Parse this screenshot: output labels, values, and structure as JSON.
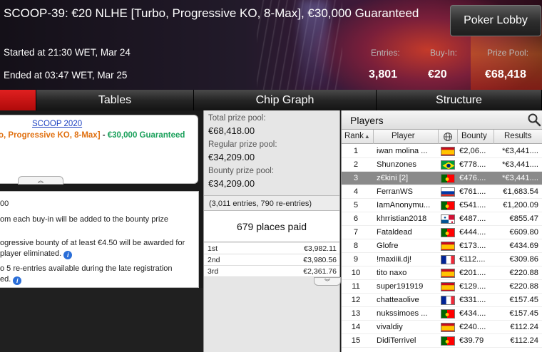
{
  "header": {
    "title": "SCOOP-39: €20 NLHE [Turbo, Progressive KO, 8-Max], €30,000 Guaranteed",
    "started": "Started at 21:30 WET, Mar 24",
    "ended": "Ended at 03:47 WET, Mar 25",
    "lobby_button": "Poker Lobby",
    "stats": [
      {
        "label": "Entries:",
        "value": "3,801"
      },
      {
        "label": "Buy-In:",
        "value": "€20"
      },
      {
        "label": "Prize Pool:",
        "value": "€68,418"
      }
    ]
  },
  "tabs": [
    {
      "label": ""
    },
    {
      "label": "Tables"
    },
    {
      "label": "Chip Graph"
    },
    {
      "label": "Structure"
    }
  ],
  "info": {
    "series_link": "SCOOP 2020",
    "name_orange": "o, Progressive KO, 8-Max]",
    "name_sep": " - ",
    "name_green": "€30,000 Guaranteed",
    "lines": [
      "00",
      "om each buy-in will be added to the bounty prize",
      "",
      "ogressive bounty of at least €4.50 will be awarded for",
      " player eliminated.",
      "o 5 re-entries available during the late registration",
      "ed."
    ]
  },
  "prizes": {
    "total_label": "Total prize pool:",
    "total_value": "€68,418.00",
    "regular_label": "Regular prize pool:",
    "regular_value": "€34,209.00",
    "bounty_label": "Bounty prize pool:",
    "bounty_value": "€34,209.00",
    "entries_text": "(3,011 entries, 790 re-entries)",
    "places_paid": "679 places paid",
    "table": [
      {
        "place": "1st",
        "amount": "€3,982.11"
      },
      {
        "place": "2nd",
        "amount": "€3,980.56"
      },
      {
        "place": "3rd",
        "amount": "€2,361.76"
      }
    ]
  },
  "players": {
    "title": "Players",
    "columns": {
      "rank": "Rank",
      "player": "Player",
      "bounty": "Bounty",
      "results": "Results"
    },
    "rows": [
      {
        "rank": "1",
        "name": "iwan molina ...",
        "flag": "spain",
        "bounty": "€2,06...",
        "result": "*€3,441...."
      },
      {
        "rank": "2",
        "name": "Shunzones",
        "flag": "brazil",
        "bounty": "€778....",
        "result": "*€3,441...."
      },
      {
        "rank": "3",
        "name": "z€kini [2]",
        "flag": "portugal",
        "bounty": "€476....",
        "result": "*€3,441...."
      },
      {
        "rank": "4",
        "name": "FerranWS",
        "flag": "russia",
        "bounty": "€761....",
        "result": "€1,683.54"
      },
      {
        "rank": "5",
        "name": "IamAnonymu...",
        "flag": "portugal",
        "bounty": "€541....",
        "result": "€1,200.09"
      },
      {
        "rank": "6",
        "name": "khrristian2018",
        "flag": "panama",
        "bounty": "€487....",
        "result": "€855.47"
      },
      {
        "rank": "7",
        "name": "Fataldead",
        "flag": "portugal",
        "bounty": "€444....",
        "result": "€609.80"
      },
      {
        "rank": "8",
        "name": "Glofre",
        "flag": "spain",
        "bounty": "€173....",
        "result": "€434.69"
      },
      {
        "rank": "9",
        "name": "!maxiiii.dj!",
        "flag": "france",
        "bounty": "€112....",
        "result": "€309.86"
      },
      {
        "rank": "10",
        "name": "tito naxo",
        "flag": "spain",
        "bounty": "€201....",
        "result": "€220.88"
      },
      {
        "rank": "11",
        "name": "super191919",
        "flag": "spain",
        "bounty": "€129....",
        "result": "€220.88"
      },
      {
        "rank": "12",
        "name": "chatteaolive",
        "flag": "france",
        "bounty": "€331....",
        "result": "€157.45"
      },
      {
        "rank": "13",
        "name": "nukssimoes ...",
        "flag": "portugal",
        "bounty": "€434....",
        "result": "€157.45"
      },
      {
        "rank": "14",
        "name": "vivaldiy",
        "flag": "spain",
        "bounty": "€240....",
        "result": "€112.24"
      },
      {
        "rank": "15",
        "name": "DidiTerrivel",
        "flag": "portugal",
        "bounty": "€39.79",
        "result": "€112.24"
      }
    ],
    "selected_rank": "3"
  },
  "colors": {
    "accent_red": "#c81010",
    "selected_row": "#8a8a8a",
    "link_blue": "#1a3fc0",
    "orange": "#e07010",
    "green": "#19a05a"
  }
}
